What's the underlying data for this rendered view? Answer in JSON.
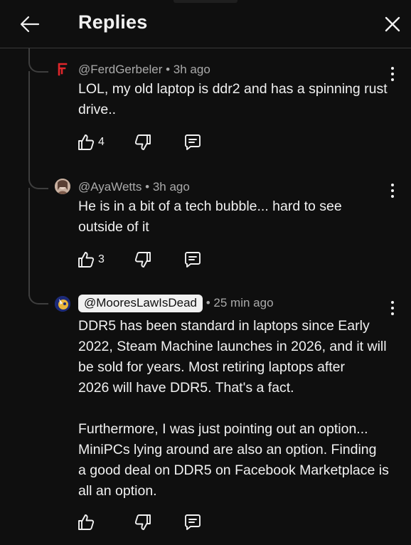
{
  "header": {
    "title": "Replies"
  },
  "comments": [
    {
      "handle": "@FerdGerbeler",
      "time": "3h ago",
      "text_lines": [
        "LOL, my old laptop is ddr2 and has a spinning rust",
        "drive.."
      ],
      "likes": "4",
      "avatar_color": "#e0262b"
    },
    {
      "handle": "@AyaWetts",
      "time": "3h ago",
      "text_lines": [
        "He is in a bit of a tech bubble... hard to see",
        "outside of it"
      ],
      "likes": "3",
      "avatar_color": "#b89a86"
    },
    {
      "handle": "@MooresLawIsDead",
      "time": "25 min ago",
      "text_lines": [
        "DDR5 has been standard in laptops since Early",
        "2022, Steam Machine launches in 2026, and it will",
        "be sold for years.  Most retiring laptops after",
        "2026 will have DDR5. That's a fact.",
        "",
        "Furthermore, I was just pointing out an option...",
        "MiniPCs lying around are also an option.  Finding",
        "a good deal on DDR5 on Facebook Marketplace is",
        "all an option."
      ],
      "likes": "",
      "avatar_color": "#2b3a8a"
    }
  ],
  "separator": "•",
  "icons": [
    "back-arrow-icon",
    "close-icon",
    "thumbs-up-icon",
    "thumbs-down-icon",
    "reply-icon",
    "more-options-icon"
  ]
}
